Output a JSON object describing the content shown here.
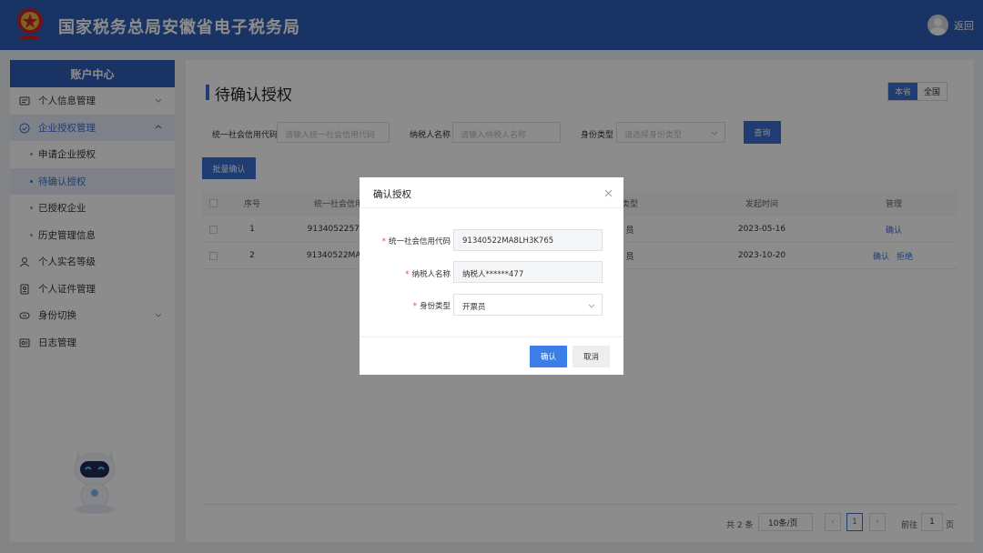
{
  "header": {
    "title": "国家税务总局安徽省电子税务局",
    "back_label": "返回"
  },
  "sidebar": {
    "title": "账户中心",
    "items": [
      {
        "label": "个人信息管理",
        "icon": "id-card-icon",
        "has_chevron": true
      },
      {
        "label": "企业授权管理",
        "icon": "check-circle-icon",
        "has_chevron": true,
        "open": true
      },
      {
        "label": "个人实名等级",
        "icon": "user-icon"
      },
      {
        "label": "个人证件管理",
        "icon": "document-icon"
      },
      {
        "label": "身份切换",
        "icon": "switch-icon",
        "has_chevron": true
      },
      {
        "label": "日志管理",
        "icon": "log-icon"
      }
    ],
    "sub_items": [
      {
        "label": "申请企业授权"
      },
      {
        "label": "待确认授权",
        "active": true
      },
      {
        "label": "已授权企业"
      },
      {
        "label": "历史管理信息"
      }
    ]
  },
  "main": {
    "title": "待确认授权",
    "scope": {
      "local": "本省",
      "national": "全国"
    },
    "filters": {
      "code_label": "统一社会信用代码",
      "code_placeholder": "请输入统一社会信用代码",
      "name_label": "纳税人名称",
      "name_placeholder": "请输入纳税人名称",
      "type_label": "身份类型",
      "type_placeholder": "请选择身份类型",
      "query_button": "查询"
    },
    "batch_button": "批量确认",
    "table": {
      "headers": {
        "index": "序号",
        "code": "统一社会信用",
        "type": "类型",
        "time": "发起时间",
        "manage": "管理"
      },
      "rows": [
        {
          "index": "1",
          "code": "913405225757",
          "type": "员",
          "time": "2023-05-16",
          "actions": [
            "确认"
          ]
        },
        {
          "index": "2",
          "code": "91340522MA8L",
          "type": "员",
          "time": "2023-10-20",
          "actions": [
            "确认",
            "拒绝"
          ]
        }
      ]
    },
    "pager": {
      "total": "共 2 条",
      "page_size": "10条/页",
      "current": "1",
      "goto_label": "前往",
      "goto_value": "1",
      "page_unit": "页"
    }
  },
  "modal": {
    "title": "确认授权",
    "fields": {
      "code_label": "统一社会信用代码",
      "code_value": "91340522MA8LH3K765",
      "name_label": "纳税人名称",
      "name_value": "纳税人******477",
      "type_label": "身份类型",
      "type_value": "开票员"
    },
    "confirm_button": "确认",
    "cancel_button": "取消"
  },
  "colors": {
    "brand": "#2e5fb7",
    "accent": "#3a6fcf",
    "required": "#e5484d"
  }
}
